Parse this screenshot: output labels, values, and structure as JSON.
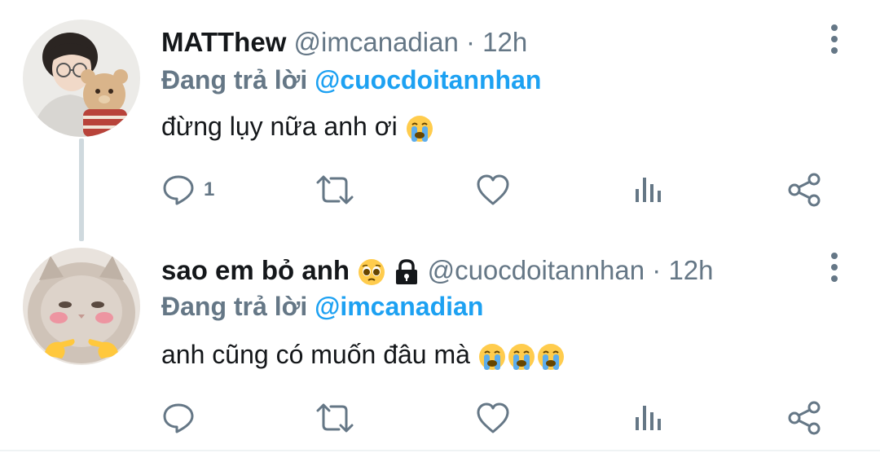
{
  "tweets": [
    {
      "name": "MATThew",
      "handle": "@imcanadian",
      "separator": "·",
      "time": "12h",
      "reply_label": "Đang trả lời",
      "reply_to": "@cuocdoitannhan",
      "text": "đừng lụy nữa anh ơi",
      "text_emojis": [
        "crying-face"
      ],
      "reply_count": "1"
    },
    {
      "name": "sao em bỏ anh",
      "name_emojis": [
        "pleading-face",
        "lock"
      ],
      "handle": "@cuocdoitannhan",
      "separator": "·",
      "time": "12h",
      "reply_label": "Đang trả lời",
      "reply_to": "@imcanadian",
      "text": "anh cũng có muốn đâu mà",
      "text_emojis": [
        "crying-face",
        "crying-face",
        "crying-face"
      ],
      "reply_count": ""
    }
  ],
  "icons": [
    "reply-icon",
    "retweet-icon",
    "like-icon",
    "views-icon",
    "share-icon",
    "more-icon"
  ],
  "colors": {
    "accent": "#1da1f2",
    "secondary": "#657786",
    "text": "#14171a"
  }
}
